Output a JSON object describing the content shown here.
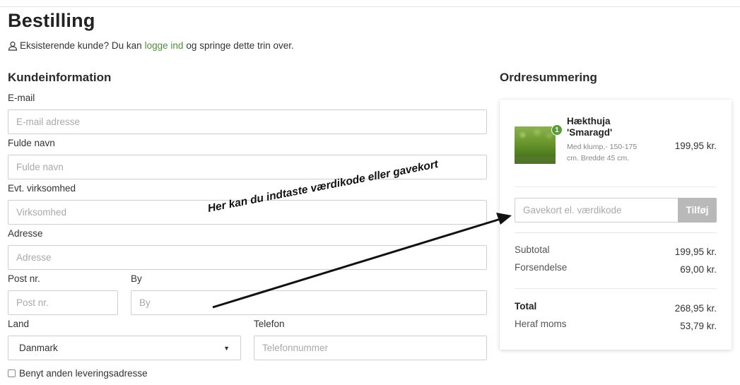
{
  "page": {
    "title": "Bestilling",
    "login_prefix": "Eksisterende kunde? Du kan",
    "login_link": "logge ind",
    "login_suffix": "og springe dette trin over."
  },
  "customer": {
    "section_title": "Kundeinformation",
    "email_label": "E-mail",
    "email_placeholder": "E-mail adresse",
    "name_label": "Fulde navn",
    "name_placeholder": "Fulde navn",
    "company_label": "Evt. virksomhed",
    "company_placeholder": "Virksomhed",
    "address_label": "Adresse",
    "address_placeholder": "Adresse",
    "zip_label": "Post nr.",
    "zip_placeholder": "Post nr.",
    "city_label": "By",
    "city_placeholder": "By",
    "country_label": "Land",
    "country_value": "Danmark",
    "phone_label": "Telefon",
    "phone_placeholder": "Telefonnummer",
    "alt_delivery_label": "Benyt anden leveringsadresse"
  },
  "summary": {
    "section_title": "Ordresummering",
    "product": {
      "name": "Hækthuja 'Smaragd'",
      "description": "Med klump,- 150-175 cm. Bredde 45 cm.",
      "price": "199,95 kr.",
      "quantity": "1"
    },
    "gift_placeholder": "Gavekort el. værdikode",
    "gift_button": "Tilføj",
    "subtotal_label": "Subtotal",
    "subtotal_value": "199,95 kr.",
    "shipping_label": "Forsendelse",
    "shipping_value": "69,00 kr.",
    "total_label": "Total",
    "total_value": "268,95 kr.",
    "vat_label": "Heraf moms",
    "vat_value": "53,79 kr."
  },
  "annotation": {
    "text": "Her kan du indtaste værdikode eller gavekort"
  },
  "colors": {
    "link": "#4e8f3a",
    "badge": "#5b9b3a",
    "button": "#b9b9b9"
  }
}
